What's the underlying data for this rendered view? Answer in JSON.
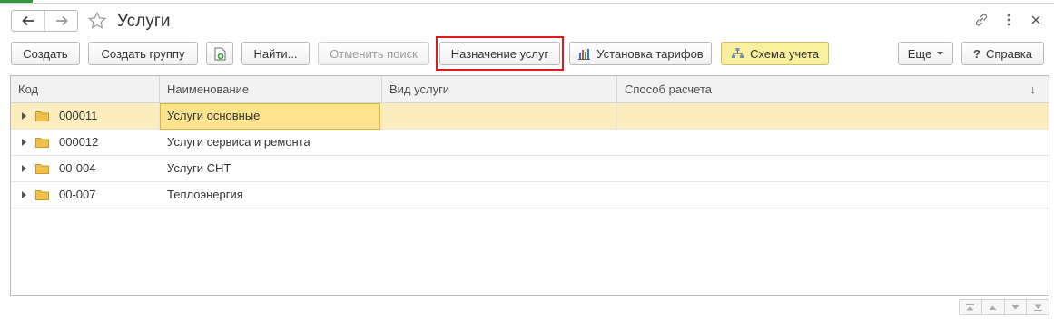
{
  "window": {
    "title": "Услуги",
    "nav_icons": [
      "arrow-left-icon",
      "arrow-right-icon"
    ],
    "favorite_icon": "star-icon",
    "right_icons": [
      "link-icon",
      "more-vertical-icon",
      "close-icon"
    ]
  },
  "toolbar": {
    "create": "Создать",
    "create_group": "Создать группу",
    "copy_icon": "add-document-icon",
    "find": "Найти...",
    "cancel_search": "Отменить поиск",
    "assign_services": "Назначение услуг",
    "set_tariffs": "Установка тарифов",
    "set_tariffs_icon": "bar-chart-icon",
    "accounting_scheme": "Схема учета",
    "accounting_scheme_icon": "hierarchy-icon",
    "more": "Еще",
    "help": "Справка",
    "help_icon": "question-icon"
  },
  "table": {
    "columns": [
      "Код",
      "Наименование",
      "Вид услуги",
      "Способ расчета"
    ],
    "sort_indicator": "↓",
    "rows": [
      {
        "code": "000011",
        "name": "Услуги основные",
        "service_type": "",
        "calc_method": "",
        "selected": true
      },
      {
        "code": "000012",
        "name": "Услуги сервиса и ремонта",
        "service_type": "",
        "calc_method": "",
        "selected": false
      },
      {
        "code": "00-004",
        "name": "Услуги СНТ",
        "service_type": "",
        "calc_method": "",
        "selected": false
      },
      {
        "code": "00-007",
        "name": "Теплоэнергия",
        "service_type": "",
        "calc_method": "",
        "selected": false
      }
    ]
  },
  "colors": {
    "selected_row": "#fbedbe",
    "focused_cell": "#fce48f",
    "folder": "#f0c04a",
    "highlight_frame": "#e0191f",
    "pressed_button": "#fbef9e"
  }
}
